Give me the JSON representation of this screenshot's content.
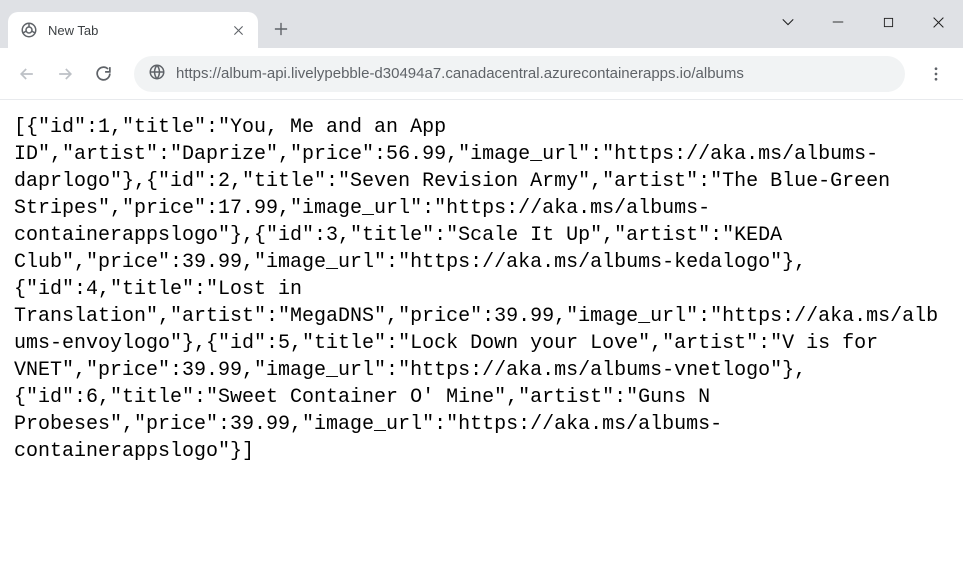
{
  "window": {
    "tab_title": "New Tab"
  },
  "address": {
    "scheme_host": "https://album-api.livelypebble-d30494a7.canadacentral.azurecontainerapps.io/",
    "path": "albums"
  },
  "body_text": "[{\"id\":1,\"title\":\"You, Me and an App ID\",\"artist\":\"Daprize\",\"price\":56.99,\"image_url\":\"https://aka.ms/albums-daprlogo\"},{\"id\":2,\"title\":\"Seven Revision Army\",\"artist\":\"The Blue-Green Stripes\",\"price\":17.99,\"image_url\":\"https://aka.ms/albums-containerappslogo\"},{\"id\":3,\"title\":\"Scale It Up\",\"artist\":\"KEDA Club\",\"price\":39.99,\"image_url\":\"https://aka.ms/albums-kedalogo\"},{\"id\":4,\"title\":\"Lost in Translation\",\"artist\":\"MegaDNS\",\"price\":39.99,\"image_url\":\"https://aka.ms/albums-envoylogo\"},{\"id\":5,\"title\":\"Lock Down your Love\",\"artist\":\"V is for VNET\",\"price\":39.99,\"image_url\":\"https://aka.ms/albums-vnetlogo\"},{\"id\":6,\"title\":\"Sweet Container O' Mine\",\"artist\":\"Guns N Probeses\",\"price\":39.99,\"image_url\":\"https://aka.ms/albums-containerappslogo\"}]"
}
